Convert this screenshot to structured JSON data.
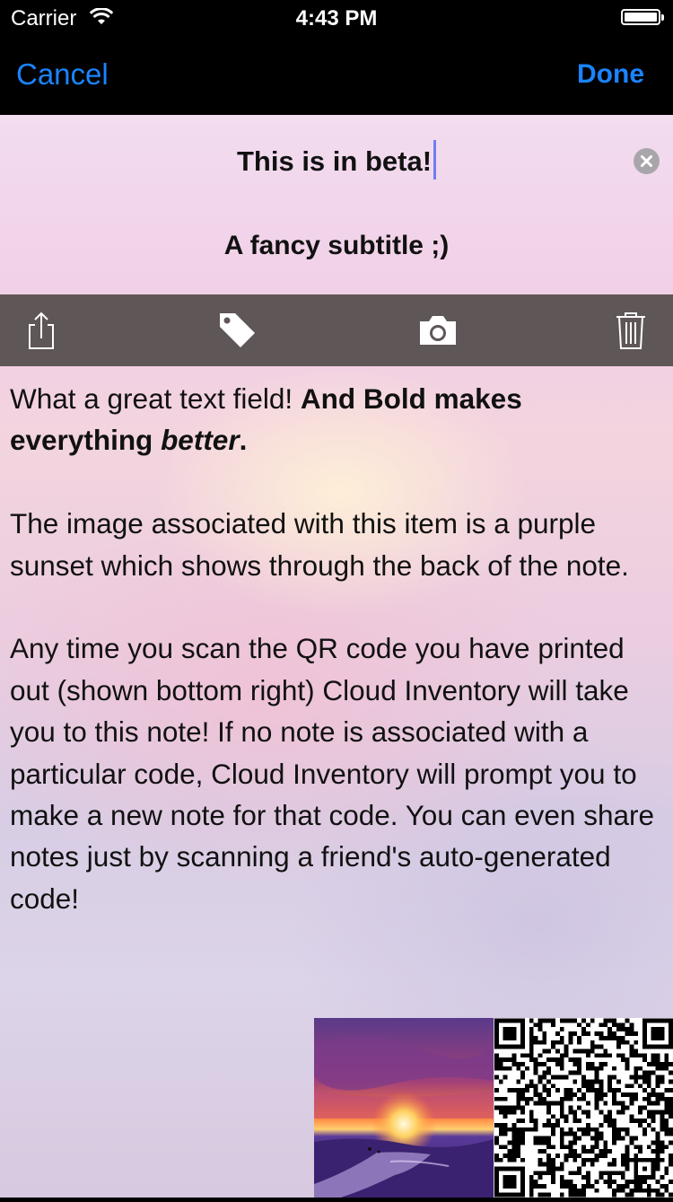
{
  "status_bar": {
    "carrier": "Carrier",
    "time": "4:43 PM"
  },
  "nav": {
    "cancel_label": "Cancel",
    "done_label": "Done"
  },
  "note": {
    "title": "This is in beta!",
    "subtitle": "A fancy subtitle ;)",
    "body": {
      "p1_normal": "What a great text field! ",
      "p1_bold": "And Bold makes everything ",
      "p1_bold_italic": "better",
      "p1_bold_end": ".",
      "p2": "The image associated with this item is a purple sunset which shows through the back of the note.",
      "p3": "Any time you scan the QR code you have printed out (shown bottom right) Cloud Inventory will take you to this note!  If no note is associated with a particular code, Cloud Inventory will prompt you to make a new note for that code.  You can even share notes just by scanning a friend's auto-generated code!"
    }
  },
  "toolbar": {
    "icons": [
      "share-icon",
      "tag-icon",
      "camera-icon",
      "trash-icon"
    ]
  },
  "colors": {
    "accent": "#1a84ff",
    "toolbar_bg": "#5f5658",
    "nav_bg": "#000000"
  }
}
